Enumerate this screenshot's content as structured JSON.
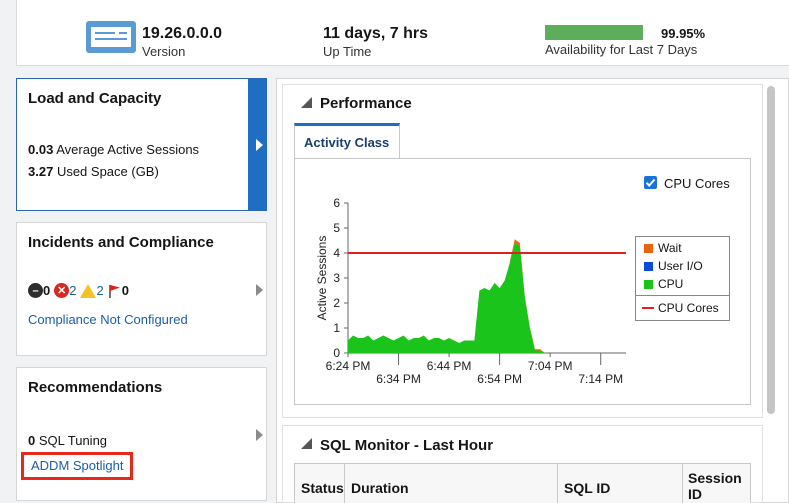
{
  "summary": {
    "version_value": "19.26.0.0.0",
    "version_label": "Version",
    "uptime_value": "11 days, 7 hrs",
    "uptime_label": "Up Time",
    "availability_pct": "99.95%",
    "availability_fraction": 0.9995,
    "availability_label": "Availability for Last 7 Days",
    "availability_color": "#5cae5b"
  },
  "cards": {
    "load": {
      "title": "Load and Capacity",
      "aas_value": "0.03",
      "aas_label": "Average Active Sessions",
      "space_value": "3.27",
      "space_label": "Used Space (GB)"
    },
    "incidents": {
      "title": "Incidents and Compliance",
      "fatal_count": "0",
      "critical_count": "2",
      "warning_count": "2",
      "flag_count": "0",
      "compliance_link": "Compliance Not Configured"
    },
    "recommendations": {
      "title": "Recommendations",
      "sql_tuning_count": "0",
      "sql_tuning_label": "SQL Tuning",
      "addm_link": "ADDM Spotlight"
    }
  },
  "performance": {
    "title": "Performance",
    "tab_label": "Activity Class",
    "cpu_cores_checkbox_label": "CPU Cores",
    "cpu_cores_checked": true
  },
  "chart_data": {
    "type": "area",
    "ylabel": "Active Sessions",
    "ylim": [
      0,
      6
    ],
    "yticks": [
      "0",
      "1",
      "2",
      "3",
      "4",
      "5",
      "6"
    ],
    "x_ticks_row1": [
      "6:24 PM",
      "6:44 PM",
      "7:04 PM"
    ],
    "x_ticks_row2": [
      "6:34 PM",
      "6:54 PM",
      "7:14 PM"
    ],
    "x_tick_order": [
      "6:24 PM",
      "6:34 PM",
      "6:44 PM",
      "6:54 PM",
      "7:04 PM",
      "7:14 PM"
    ],
    "xlim_minutes": [
      0,
      55
    ],
    "cpu_cores_line": 4,
    "colors": {
      "wait": "#e8650e",
      "user_io": "#0a4cd6",
      "cpu": "#1bc41b",
      "cpu_cores": "#e02020"
    },
    "legend": [
      {
        "name": "Wait",
        "color": "#e8650e"
      },
      {
        "name": "User I/O",
        "color": "#0a4cd6"
      },
      {
        "name": "CPU",
        "color": "#1bc41b"
      }
    ],
    "legend_line": {
      "name": "CPU Cores",
      "color": "#e02020"
    },
    "series": [
      {
        "name": "CPU",
        "x_minutes": [
          0,
          1,
          2,
          3,
          4,
          5,
          6,
          7,
          8,
          9,
          10,
          11,
          12,
          13,
          14,
          15,
          16,
          17,
          18,
          19,
          20,
          21,
          22,
          23,
          24,
          25,
          26,
          27,
          28,
          29,
          30,
          31,
          32,
          33,
          34,
          35,
          36,
          37,
          38,
          39,
          40
        ],
        "values": [
          0.5,
          0.7,
          0.6,
          0.6,
          0.7,
          0.5,
          0.6,
          0.7,
          0.6,
          0.5,
          0.6,
          0.7,
          0.5,
          0.6,
          0.6,
          0.7,
          0.5,
          0.6,
          0.6,
          0.5,
          0.6,
          0.5,
          0.4,
          0.5,
          0.5,
          0.5,
          2.5,
          2.6,
          2.5,
          2.8,
          2.6,
          2.9,
          3.6,
          4.4,
          4.3,
          2.2,
          1.0,
          0.1,
          0.1,
          0.0,
          0.0
        ]
      },
      {
        "name": "Wait",
        "x_minutes": [
          32,
          33,
          34,
          35,
          36,
          37,
          38,
          39
        ],
        "values": [
          0.05,
          0.15,
          0.1,
          0.05,
          0.0,
          0.05,
          0.05,
          0.0
        ]
      }
    ]
  },
  "sql_monitor": {
    "title": "SQL Monitor - Last Hour",
    "columns": [
      "Status",
      "Duration",
      "SQL ID",
      "Session ID"
    ]
  }
}
